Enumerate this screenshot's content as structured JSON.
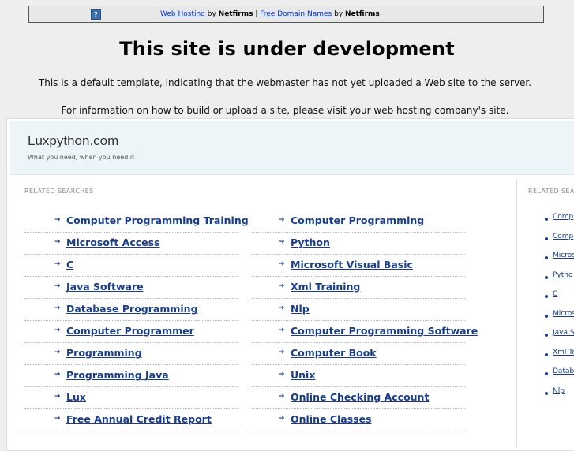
{
  "topbar": {
    "help_icon": "question-icon",
    "link1": "Web Hosting",
    "by1": " by ",
    "brand1": "Netfirms",
    "sep": " | ",
    "link2": "Free Domain Names",
    "by2": " by ",
    "brand2": "Netfirms"
  },
  "heading": "This site is under development",
  "message1": "This is a default template, indicating that the webmaster has not yet uploaded a Web site to the server.",
  "message2": "For information on how to build or upload a site, please visit your web hosting company's site.",
  "site": {
    "name": "Luxpython.com",
    "tagline": "What you need, when you need it"
  },
  "related_label": "RELATED SEARCHES",
  "left_links": [
    "Computer Programming Training",
    "Microsoft Access",
    "C",
    "Java Software",
    "Database Programming",
    "Computer Programmer",
    "Programming",
    "Programming Java",
    "Lux",
    "Free Annual Credit Report"
  ],
  "right_links": [
    "Computer Programming",
    "Python",
    "Microsoft Visual Basic",
    "Xml Training",
    "Nlp",
    "Computer Programming Software",
    "Computer Book",
    "Unix",
    "Online Checking Account",
    "Online Classes"
  ],
  "sidebar": {
    "label": "RELATED SEA",
    "links": [
      "Comp",
      "Comp",
      "Micros",
      "Pytho",
      "C",
      "Micros",
      "Java S",
      "Xml Tr",
      "Datab",
      "Nlp"
    ]
  }
}
